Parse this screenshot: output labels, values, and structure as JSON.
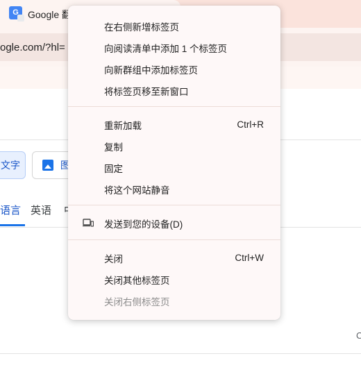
{
  "tab": {
    "title": "Google 翻",
    "favicon_text": "G"
  },
  "address": {
    "url": "ogle.com/?hl="
  },
  "page": {
    "mode_text": "文字",
    "mode_image": "图",
    "lang_detect": "语言",
    "lang_english": "英语",
    "lang_partial": "中",
    "stray_char": "C"
  },
  "context_menu": {
    "new_tab_right": "在右侧新增标签页",
    "add_reading_list": "向阅读清单中添加 1 个标签页",
    "add_to_group": "向新群组中添加标签页",
    "move_to_window": "将标签页移至新窗口",
    "reload": "重新加载",
    "reload_shortcut": "Ctrl+R",
    "duplicate": "复制",
    "pin": "固定",
    "mute_site": "将这个网站静音",
    "send_to_devices": "发送到您的设备(D)",
    "close": "关闭",
    "close_shortcut": "Ctrl+W",
    "close_others": "关闭其他标签页",
    "close_right": "关闭右侧标签页"
  },
  "icons": {
    "send_device": "devices-icon",
    "image_mode": "image-icon"
  }
}
